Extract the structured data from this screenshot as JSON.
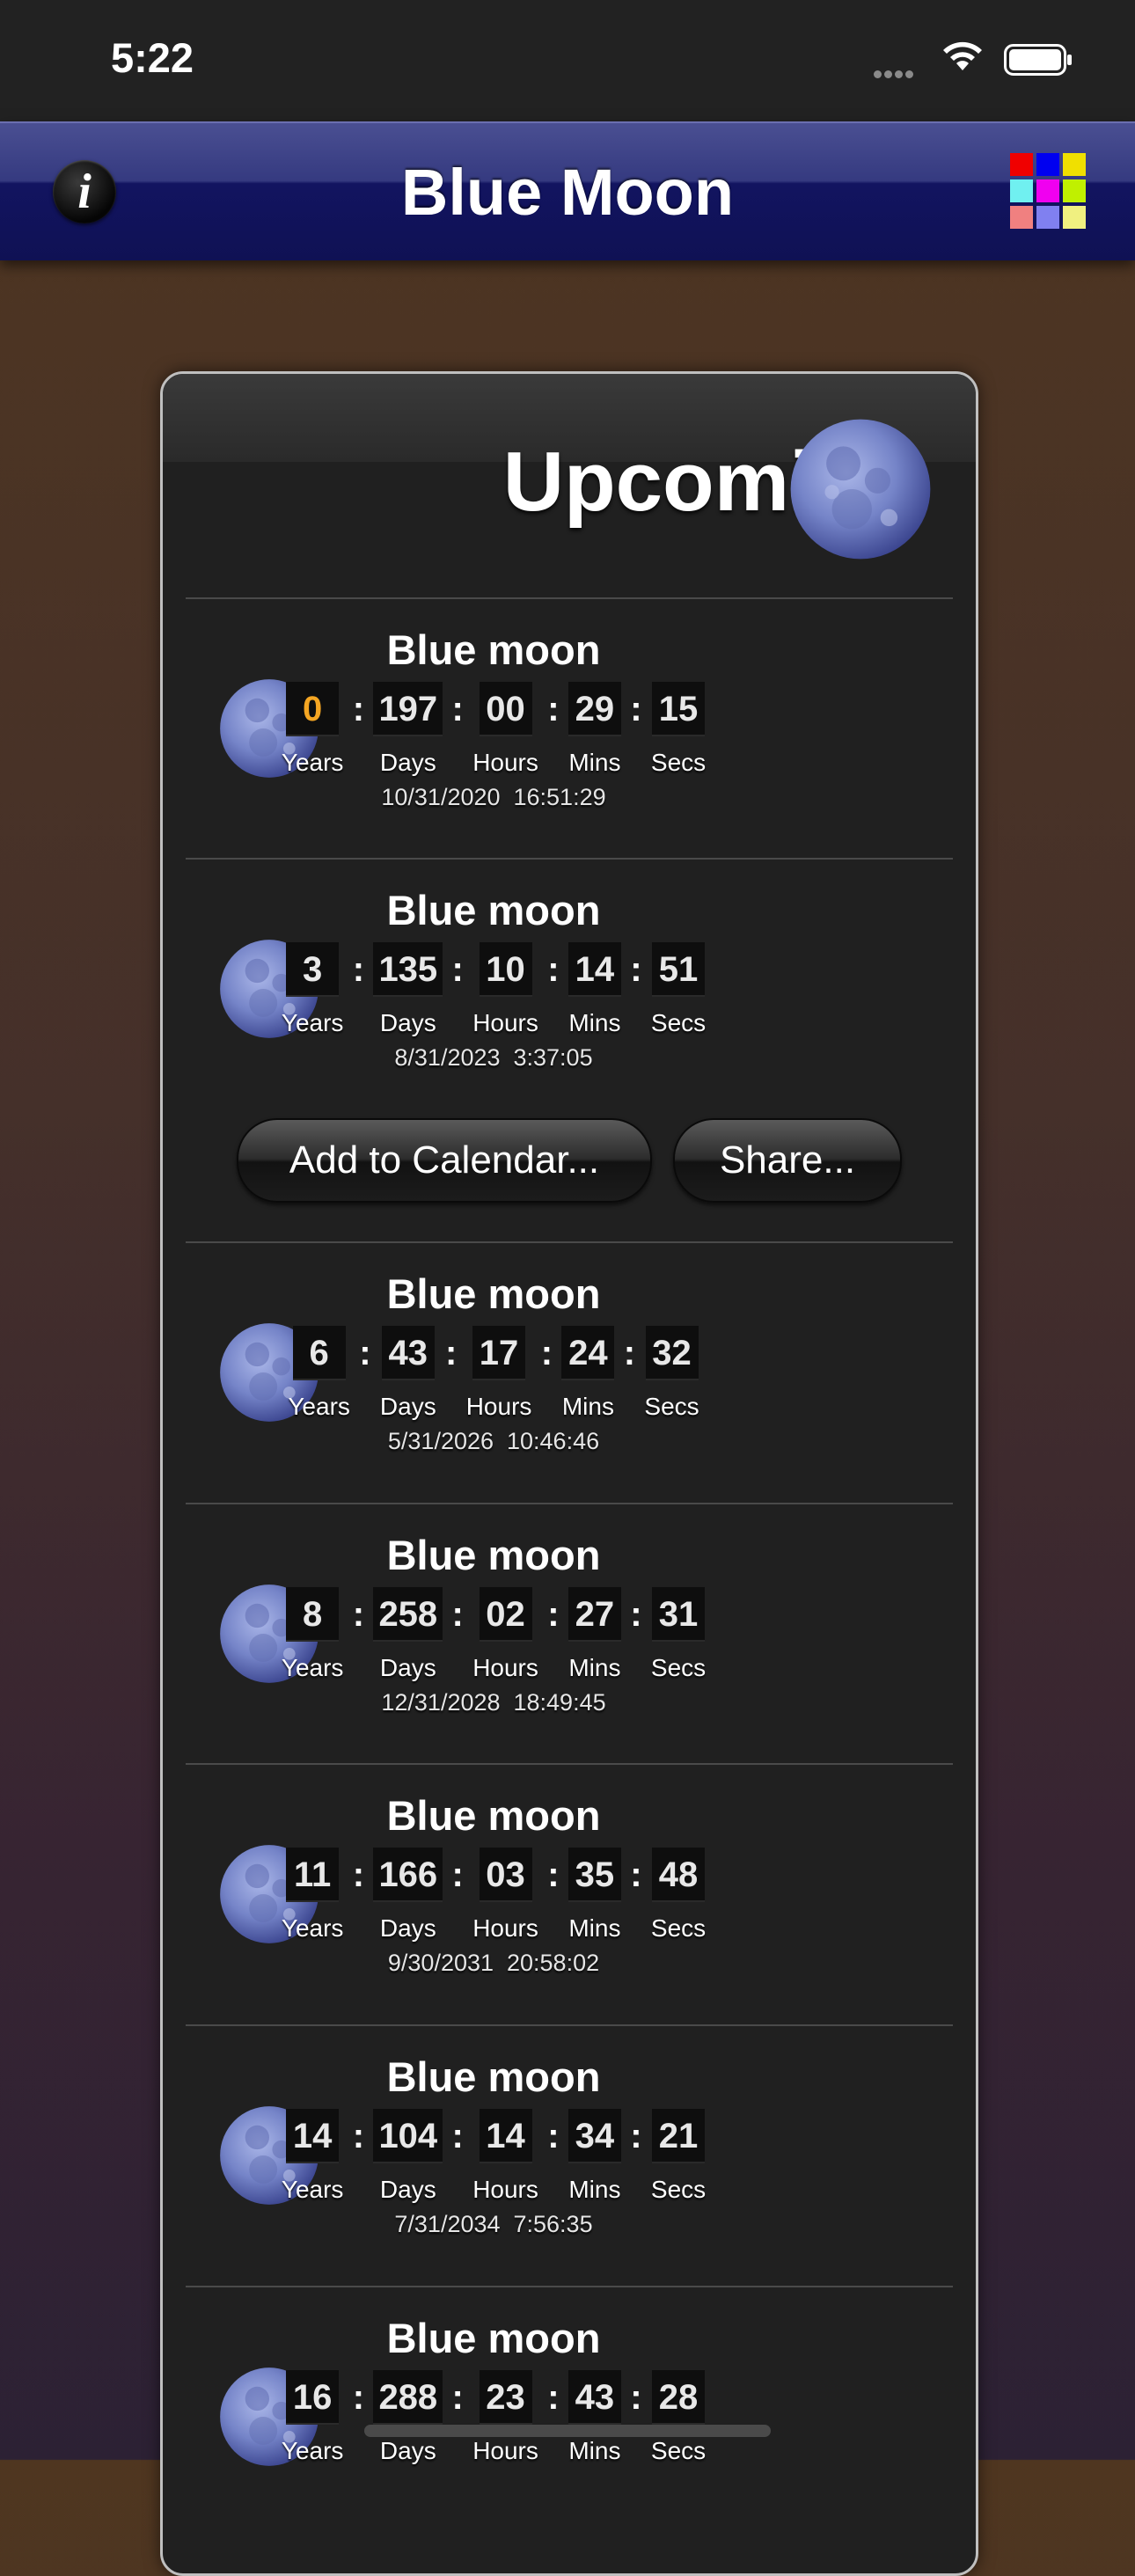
{
  "status_bar": {
    "time": "5:22"
  },
  "nav": {
    "title": "Blue Moon",
    "info_label": "i"
  },
  "grid_colors": [
    "#f00000",
    "#0000f0",
    "#f0e000",
    "#70f0f0",
    "#f000f0",
    "#c0f000",
    "#f08080",
    "#8080f0",
    "#f0f080"
  ],
  "card": {
    "title": "Upcoming"
  },
  "unit_labels": {
    "years": "Years",
    "days": "Days",
    "hours": "Hours",
    "mins": "Mins",
    "secs": "Secs"
  },
  "entries": [
    {
      "name": "Blue moon",
      "years": "0",
      "days": "197",
      "hours": "00",
      "mins": "29",
      "secs": "15",
      "date": "10/31/2020  16:51:29"
    },
    {
      "name": "Blue moon",
      "years": "3",
      "days": "135",
      "hours": "10",
      "mins": "14",
      "secs": "51",
      "date": "8/31/2023  3:37:05"
    },
    {
      "name": "Blue moon",
      "years": "6",
      "days": "43",
      "hours": "17",
      "mins": "24",
      "secs": "32",
      "date": "5/31/2026  10:46:46"
    },
    {
      "name": "Blue moon",
      "years": "8",
      "days": "258",
      "hours": "02",
      "mins": "27",
      "secs": "31",
      "date": "12/31/2028  18:49:45"
    },
    {
      "name": "Blue moon",
      "years": "11",
      "days": "166",
      "hours": "03",
      "mins": "35",
      "secs": "48",
      "date": "9/30/2031  20:58:02"
    },
    {
      "name": "Blue moon",
      "years": "14",
      "days": "104",
      "hours": "14",
      "mins": "34",
      "secs": "21",
      "date": "7/31/2034  7:56:35"
    },
    {
      "name": "Blue moon",
      "years": "16",
      "days": "288",
      "hours": "23",
      "mins": "43",
      "secs": "28",
      "date": ""
    }
  ],
  "actions": {
    "add_to_calendar": "Add to Calendar...",
    "share": "Share..."
  }
}
